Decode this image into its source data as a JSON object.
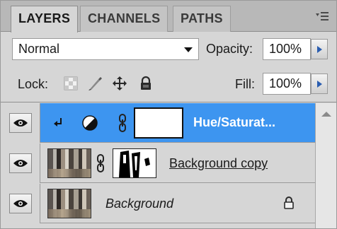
{
  "tabs": [
    {
      "label": "LAYERS",
      "active": true
    },
    {
      "label": "CHANNELS",
      "active": false
    },
    {
      "label": "PATHS",
      "active": false
    }
  ],
  "panel_menu_icon": "panel-menu-icon",
  "blend": {
    "mode": "Normal",
    "opacity_label": "Opacity:",
    "opacity_value": "100%"
  },
  "lock": {
    "label": "Lock:",
    "icons": [
      "lock-transparent-icon",
      "lock-image-icon",
      "lock-position-icon",
      "lock-all-icon"
    ],
    "fill_label": "Fill:",
    "fill_value": "100%"
  },
  "layers": [
    {
      "name": "Hue/Saturat...",
      "type": "adjustment",
      "selected": true,
      "clipped": true
    },
    {
      "name": "Background copy",
      "type": "pixel-with-mask",
      "selected": false
    },
    {
      "name": "Background",
      "type": "background",
      "selected": false,
      "locked": true
    }
  ],
  "colors": {
    "selection": "#3d95f0",
    "panel_bg": "#d6d6d6",
    "tab_bar": "#b8b8b8"
  }
}
